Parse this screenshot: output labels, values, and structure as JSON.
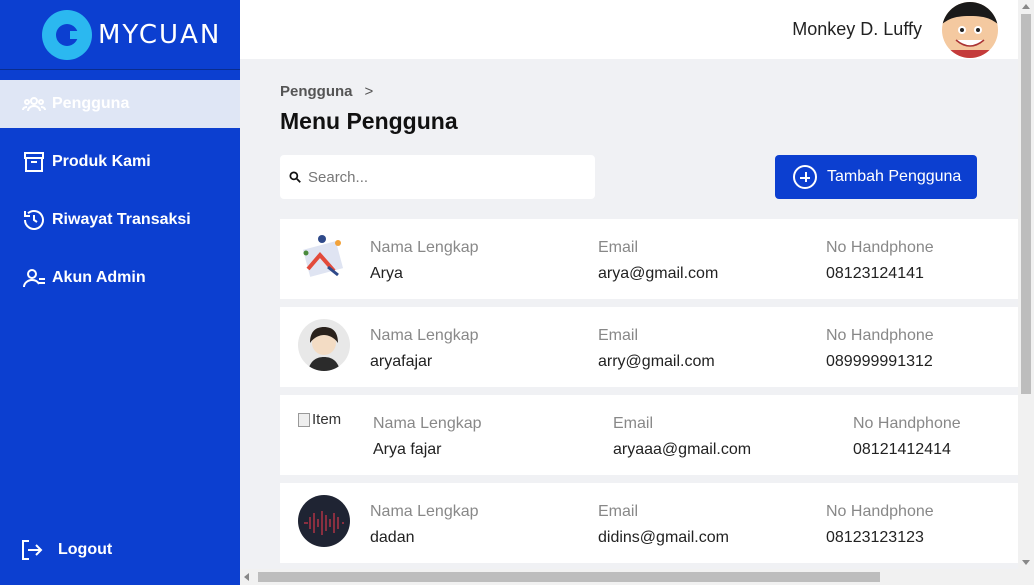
{
  "brand": {
    "name": "MYCUAN"
  },
  "sidebar": {
    "items": [
      {
        "label": "Pengguna",
        "icon": "users-icon",
        "active": true
      },
      {
        "label": "Produk Kami",
        "icon": "archive-icon",
        "active": false
      },
      {
        "label": "Riwayat Transaksi",
        "icon": "history-icon",
        "active": false
      },
      {
        "label": "Akun Admin",
        "icon": "user-admin-icon",
        "active": false
      }
    ],
    "logout_label": "Logout"
  },
  "header": {
    "username": "Monkey D. Luffy"
  },
  "breadcrumb": {
    "current": "Pengguna",
    "separator": ">"
  },
  "page": {
    "title": "Menu Pengguna"
  },
  "search": {
    "placeholder": "Search..."
  },
  "add_button": {
    "label": "Tambah Pengguna"
  },
  "users": [
    {
      "name_label": "Nama Lengkap",
      "name": "Arya",
      "email_label": "Email",
      "email": "arya@gmail.com",
      "phone_label": "No Handphone",
      "phone": "08123124141"
    },
    {
      "name_label": "Nama Lengkap",
      "name": "aryafajar",
      "email_label": "Email",
      "email": "arry@gmail.com",
      "phone_label": "No Handphone",
      "phone": "089999991312"
    },
    {
      "name_label": "Nama Lengkap",
      "name": "Arya fajar",
      "email_label": "Email",
      "email": "aryaaa@gmail.com",
      "phone_label": "No Handphone",
      "phone": "08121412414",
      "image_alt": "Item"
    },
    {
      "name_label": "Nama Lengkap",
      "name": "dadan",
      "email_label": "Email",
      "email": "didins@gmail.com",
      "phone_label": "No Handphone",
      "phone": "08123123123"
    }
  ],
  "colors": {
    "primary": "#0c3fd0",
    "accent": "#2bb8f0",
    "background": "#f0f1f4"
  }
}
